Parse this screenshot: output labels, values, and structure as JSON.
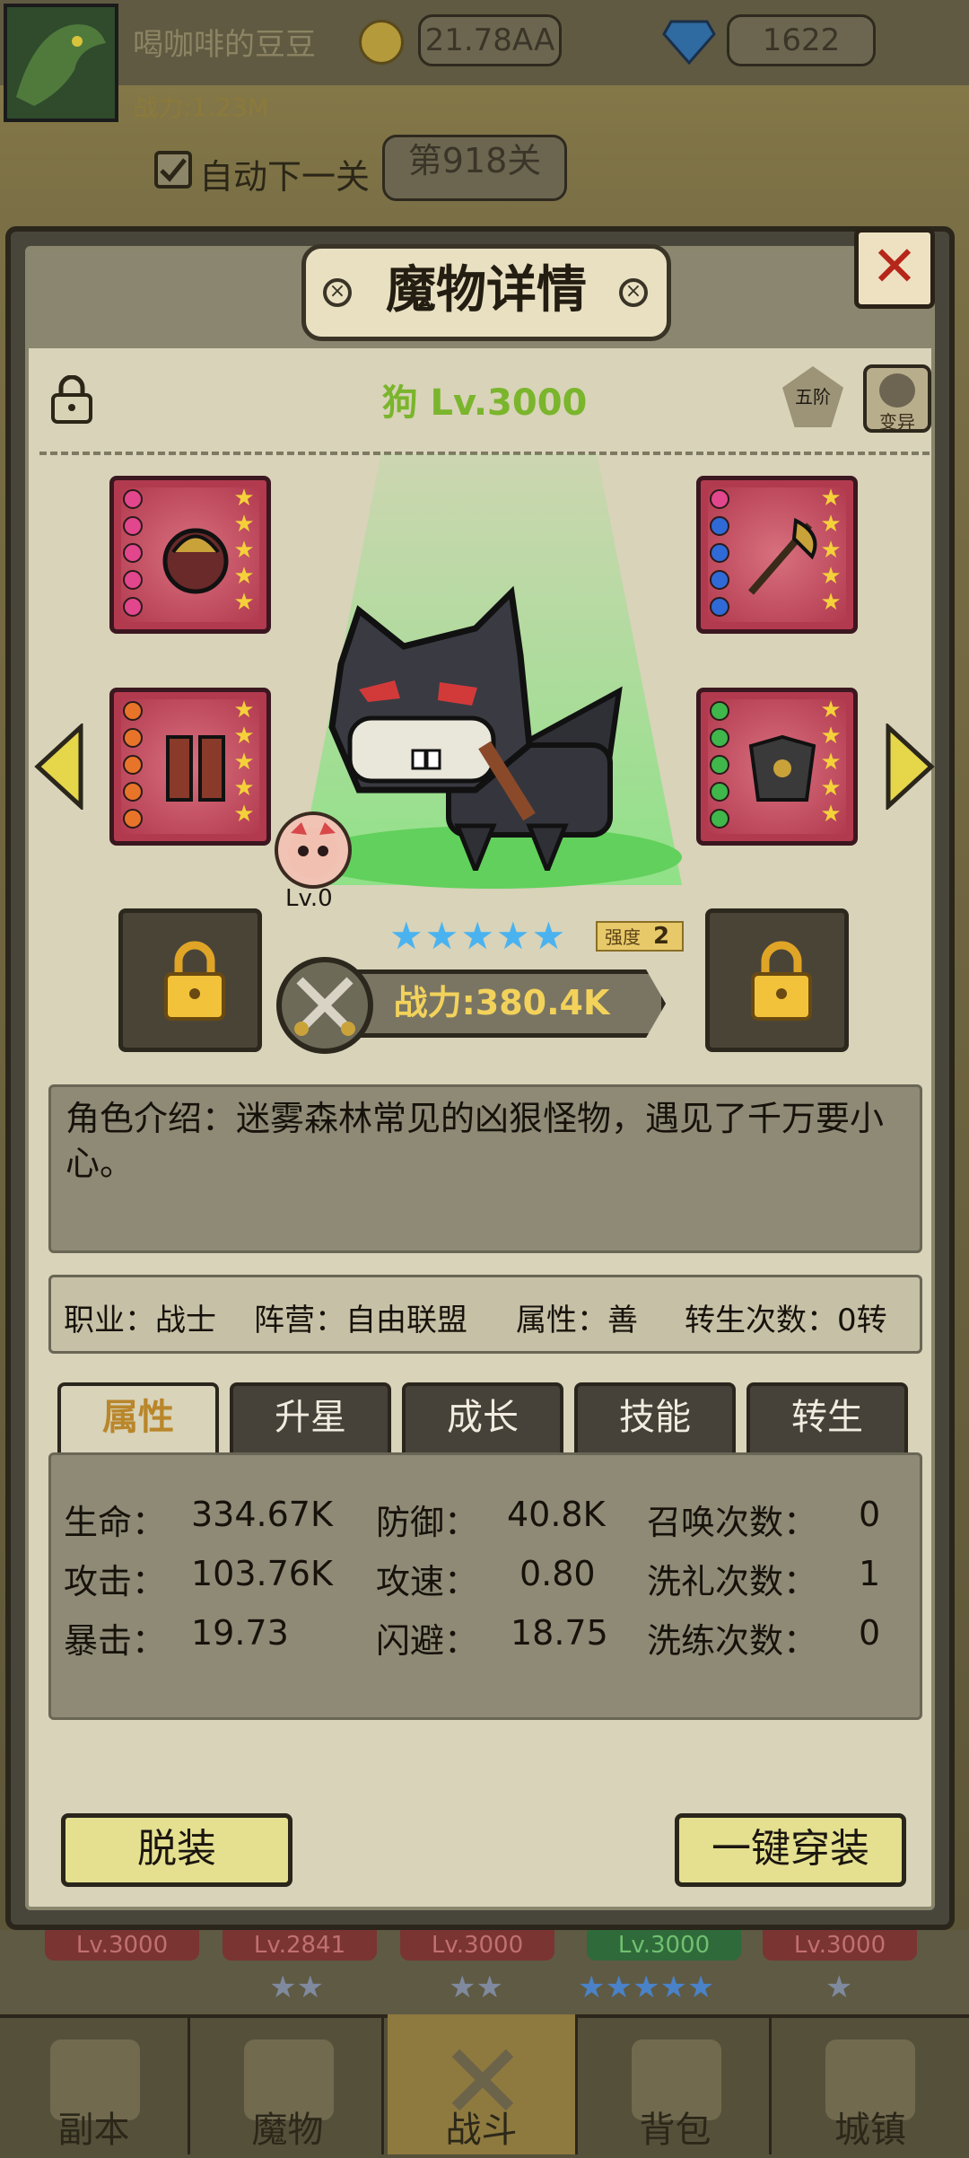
{
  "player": {
    "nickname": "喝咖啡的豆豆",
    "power": "战力:1.23M",
    "gold": "21.78AA",
    "diamonds": "1622"
  },
  "battle": {
    "auto_next_label": "自动下一关",
    "stage_label": "第918关"
  },
  "dialog": {
    "title": "魔物详情",
    "monster_name": "狗 Lv.3000",
    "grade_badge": "五阶",
    "mutate_label": "变异",
    "pet_level": "Lv.0",
    "star_count": 5,
    "strength_label": "强度",
    "strength_value": "2",
    "power": "战力:380.4K",
    "description": "角色介绍：迷雾森林常见的凶狠怪物，遇见了千万要小心。",
    "info": {
      "class": "职业：战士",
      "faction": "阵营：自由联盟",
      "attribute": "属性：善",
      "rebirth": "转生次数：0转"
    },
    "tabs": [
      "属性",
      "升星",
      "成长",
      "技能",
      "转生"
    ],
    "active_tab": 0,
    "stats": [
      {
        "label": "生命：",
        "value": "334.67K"
      },
      {
        "label": "防御：",
        "value": "40.8K"
      },
      {
        "label": "召唤次数：",
        "value": "0"
      },
      {
        "label": "攻击：",
        "value": "103.76K"
      },
      {
        "label": "攻速：",
        "value": "0.80"
      },
      {
        "label": "洗礼次数：",
        "value": "1"
      },
      {
        "label": "暴击：",
        "value": "19.73"
      },
      {
        "label": "闪避：",
        "value": "18.75"
      },
      {
        "label": "洗练次数：",
        "value": "0"
      }
    ],
    "unequip_button": "脱装",
    "equip_all_button": "一键穿装"
  },
  "hero_bar": [
    {
      "level": "Lv.3000",
      "stars": "",
      "color": "#7a3432"
    },
    {
      "level": "Lv.2841",
      "stars": "★★",
      "color": "#7a3432"
    },
    {
      "level": "Lv.3000",
      "stars": "★★",
      "color": "#7a3432"
    },
    {
      "level": "Lv.3000",
      "stars": "★★★★★",
      "color": "#2f6a3a"
    },
    {
      "level": "Lv.3000",
      "stars": "★",
      "color": "#7a3432"
    }
  ],
  "nav": {
    "items": [
      {
        "label": "副本",
        "icon": "map-icon"
      },
      {
        "label": "魔物",
        "icon": "monster-icon"
      },
      {
        "label": "战斗",
        "icon": "crossed-swords-icon"
      },
      {
        "label": "背包",
        "icon": "backpack-icon"
      },
      {
        "label": "城镇",
        "icon": "shop-icon"
      }
    ],
    "active": 2
  },
  "colors": {
    "accent_gold": "#f2d25b",
    "tab_active_text": "#b9862a",
    "name_green": "#7ab52c",
    "close_red": "#b6261b",
    "star_blue": "#4ab3ef"
  }
}
